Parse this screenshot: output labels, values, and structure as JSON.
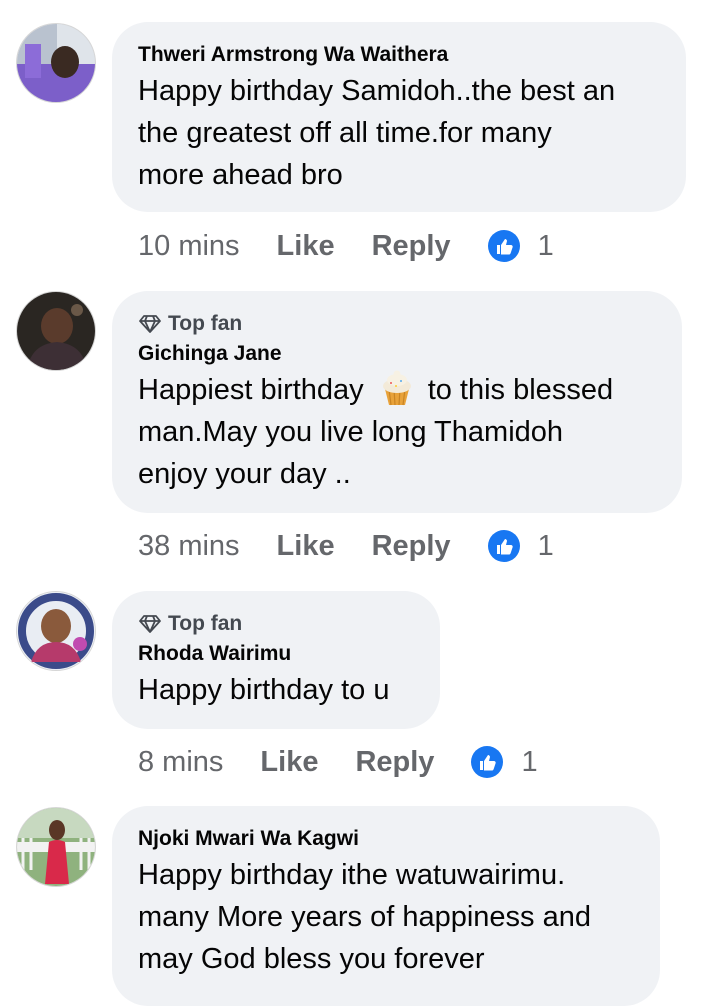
{
  "colors": {
    "bubble": "#f0f2f5",
    "meta": "#65676b",
    "like_blue": "#1877f2",
    "text": "#050505"
  },
  "comments": [
    {
      "author": "Thweri Armstrong Wa Waithera",
      "text": "Happy birthday Samidoh..the best an\nthe greatest off all time.for many\nmore ahead bro",
      "time": "10 mins",
      "like_label": "Like",
      "reply_label": "Reply",
      "reactions": "1"
    },
    {
      "badge": "Top fan",
      "author": "Gichinga Jane",
      "text_before": "Happiest birthday",
      "emoji": "cupcake",
      "text_after": "to this blessed\nman.May you live long Thamidoh\nenjoy your day ..",
      "time": "38 mins",
      "like_label": "Like",
      "reply_label": "Reply",
      "reactions": "1"
    },
    {
      "badge": "Top fan",
      "author": "Rhoda Wairimu",
      "text": "Happy birthday to u",
      "time": "8 mins",
      "like_label": "Like",
      "reply_label": "Reply",
      "reactions": "1"
    },
    {
      "author": "Njoki Mwari Wa Kagwi",
      "text": "Happy birthday ithe watuwairimu.\nmany More years of happiness and\nmay God bless you forever"
    }
  ]
}
